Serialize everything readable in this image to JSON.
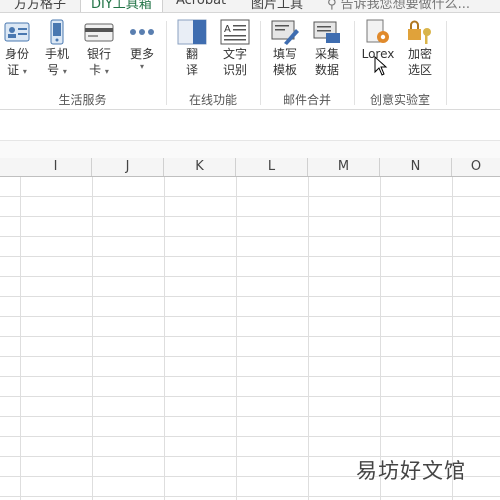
{
  "tabs": [
    {
      "label": "方方格子"
    },
    {
      "label": "DIY工具箱"
    },
    {
      "label": "Acrobat"
    },
    {
      "label": "图片工具"
    }
  ],
  "tell_me": "告诉我您想要做什么...",
  "ribbon": {
    "groups": [
      {
        "label": "生活服务",
        "buttons": [
          {
            "label": "身份证"
          },
          {
            "label": "手机号"
          },
          {
            "label": "银行卡"
          },
          {
            "label": "更多"
          }
        ]
      },
      {
        "label": "在线功能",
        "buttons": [
          {
            "label": "翻译"
          },
          {
            "label": "文字识别"
          }
        ]
      },
      {
        "label": "邮件合并",
        "buttons": [
          {
            "label": "填写模板"
          },
          {
            "label": "采集数据"
          }
        ]
      },
      {
        "label": "创意实验室",
        "buttons": [
          {
            "label": "Lorex"
          },
          {
            "label": "加密选区"
          }
        ]
      }
    ]
  },
  "columns": [
    "I",
    "J",
    "K",
    "L",
    "M",
    "N",
    "O"
  ],
  "watermark": "易坊好文馆",
  "colors": {
    "accent": "#217346",
    "grid": "#dedede",
    "header_bg": "#f5f5f5"
  }
}
